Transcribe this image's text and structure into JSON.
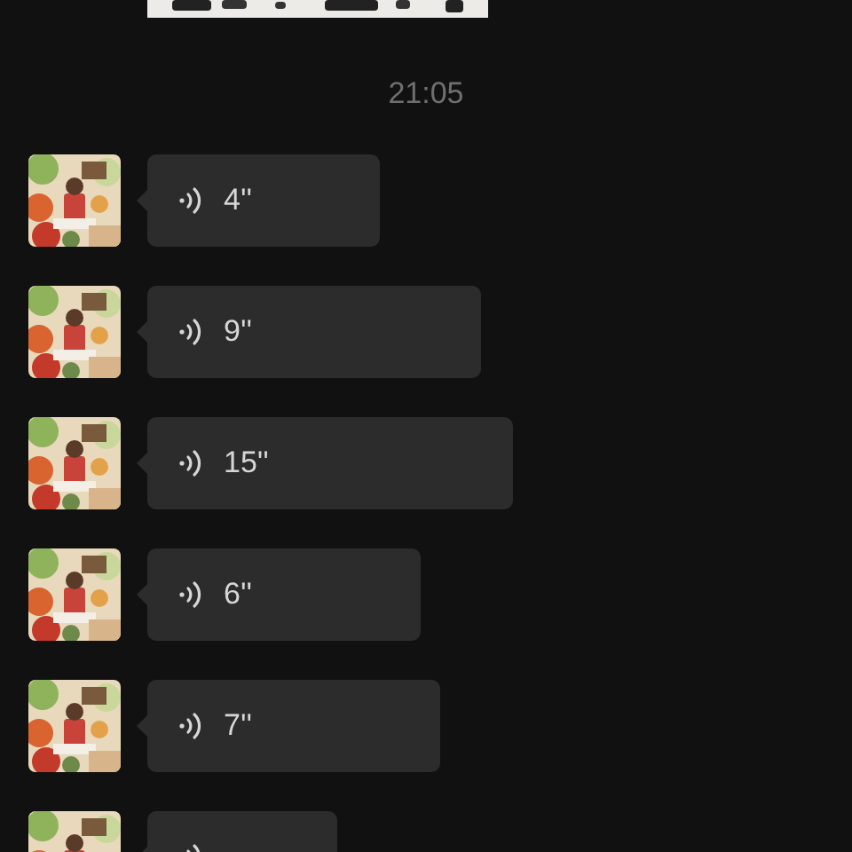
{
  "time": "21:05",
  "messages": [
    {
      "kind": "voice",
      "duration": "4''"
    },
    {
      "kind": "voice",
      "duration": "9''"
    },
    {
      "kind": "voice",
      "duration": "15''"
    },
    {
      "kind": "voice",
      "duration": "6''"
    },
    {
      "kind": "voice",
      "duration": "7''"
    },
    {
      "kind": "voice"
    }
  ]
}
